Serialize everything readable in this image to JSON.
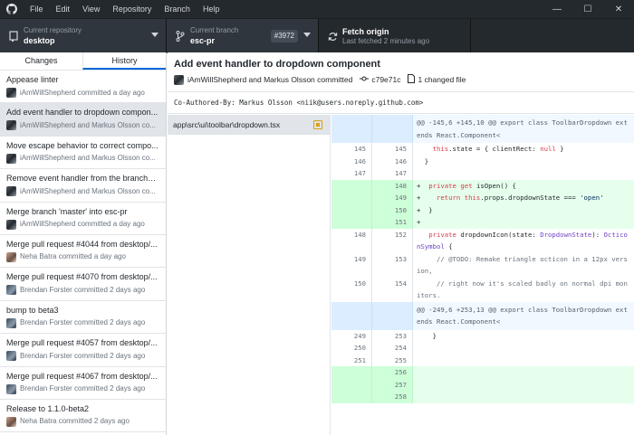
{
  "titlebar": {
    "menu": [
      "File",
      "Edit",
      "View",
      "Repository",
      "Branch",
      "Help"
    ],
    "minimize": "—",
    "maximize": "☐",
    "close": "✕"
  },
  "toolbar": {
    "repo_label": "Current repository",
    "repo_name": "desktop",
    "branch_label": "Current branch",
    "branch_name": "esc-pr",
    "pr_badge": "#3972",
    "fetch_label": "Fetch origin",
    "fetch_sub": "Last fetched 2 minutes ago"
  },
  "sidebar": {
    "tabs": [
      "Changes",
      "History"
    ],
    "commits": [
      {
        "summary": "Appease linter",
        "meta": "iAmWillShepherd committed a day ago"
      },
      {
        "summary": "Add event handler to dropdown compon...",
        "meta": "iAmWillShepherd and Markus Olsson co..."
      },
      {
        "summary": "Move escape behavior to correct compo...",
        "meta": "iAmWillShepherd and Markus Olsson co..."
      },
      {
        "summary": "Remove event handler from the branches...",
        "meta": "iAmWillShepherd and Markus Olsson co..."
      },
      {
        "summary": "Merge branch 'master' into esc-pr",
        "meta": "iAmWillShepherd committed a day ago"
      },
      {
        "summary": "Merge pull request #4044 from desktop/...",
        "meta": "Neha Batra committed a day ago"
      },
      {
        "summary": "Merge pull request #4070 from desktop/...",
        "meta": "Brendan Forster committed 2 days ago"
      },
      {
        "summary": "bump to beta3",
        "meta": "Brendan Forster committed 2 days ago"
      },
      {
        "summary": "Merge pull request #4057 from desktop/...",
        "meta": "Brendan Forster committed 2 days ago"
      },
      {
        "summary": "Merge pull request #4067 from desktop/...",
        "meta": "Brendan Forster committed 2 days ago"
      },
      {
        "summary": "Release to 1.1.0-beta2",
        "meta": "Neha Batra committed 2 days ago"
      }
    ]
  },
  "commit": {
    "title": "Add event handler to dropdown component",
    "authors": "iAmWillShepherd and Markus Olsson committed",
    "sha": "c79e71c",
    "files_changed": "1 changed file",
    "description": "Co-Authored-By: Markus Olsson <niik@users.noreply.github.com>"
  },
  "files": [
    {
      "path": "app\\src\\ui\\toolbar\\dropdown.tsx"
    }
  ],
  "diff": [
    {
      "type": "hunk",
      "old": "",
      "new": "",
      "text": "@@ -145,6 +145,10 @@ export class ToolbarDropdown extends React.Component<"
    },
    {
      "type": "ctx",
      "old": "145",
      "new": "145",
      "text": "    this.state = { clientRect: null }"
    },
    {
      "type": "ctx",
      "old": "146",
      "new": "146",
      "text": "  }"
    },
    {
      "type": "ctx",
      "old": "147",
      "new": "147",
      "text": ""
    },
    {
      "type": "add",
      "old": "",
      "new": "148",
      "text": "+  private get isOpen() {"
    },
    {
      "type": "add",
      "old": "",
      "new": "149",
      "text": "+    return this.props.dropdownState === 'open'"
    },
    {
      "type": "add",
      "old": "",
      "new": "150",
      "text": "+  }"
    },
    {
      "type": "add",
      "old": "",
      "new": "151",
      "text": "+"
    },
    {
      "type": "ctx",
      "old": "148",
      "new": "152",
      "text": "   private dropdownIcon(state: DropdownState): OcticonSymbol {"
    },
    {
      "type": "ctx",
      "old": "149",
      "new": "153",
      "text": "     // @TODO: Remake triangle octicon in a 12px version,"
    },
    {
      "type": "ctx",
      "old": "150",
      "new": "154",
      "text": "     // right now it's scaled badly on normal dpi monitors."
    },
    {
      "type": "hunk",
      "old": "",
      "new": "",
      "text": "@@ -249,6 +253,13 @@ export class ToolbarDropdown extends React.Component<"
    },
    {
      "type": "ctx",
      "old": "249",
      "new": "253",
      "text": "    }"
    },
    {
      "type": "ctx",
      "old": "250",
      "new": "254",
      "text": ""
    },
    {
      "type": "ctx",
      "old": "251",
      "new": "255",
      "text": ""
    },
    {
      "type": "add",
      "old": "",
      "new": "256",
      "text": ""
    },
    {
      "type": "add",
      "old": "",
      "new": "257",
      "text": ""
    },
    {
      "type": "add",
      "old": "",
      "new": "258",
      "text": ""
    }
  ]
}
